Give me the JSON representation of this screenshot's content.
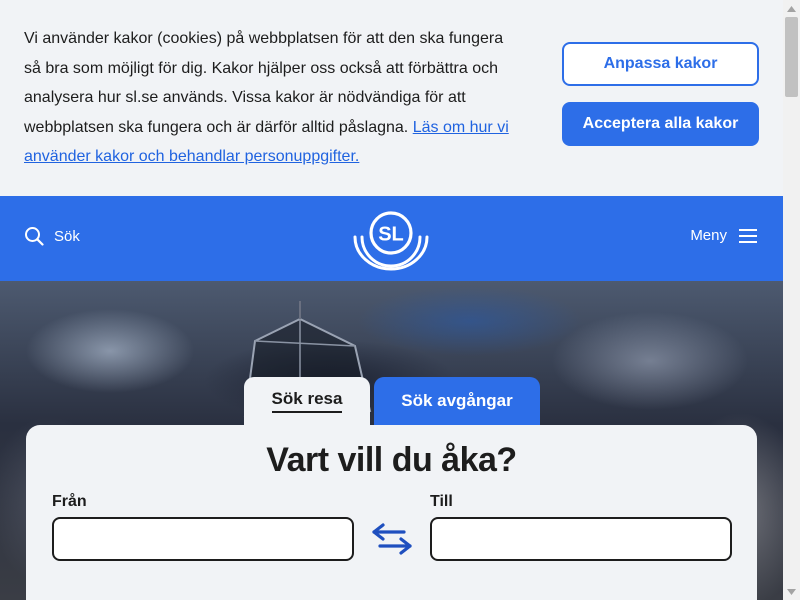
{
  "cookie_banner": {
    "text": "Vi använder kakor (cookies) på webbplatsen för att den ska fungera så bra som möjligt för dig. Kakor hjälper oss också att förbättra och analysera hur sl.se används. Vissa kakor är nödvändiga för att webbplatsen ska fungera och är därför alltid påslagna.",
    "link_text": "Läs om hur vi använder kakor och behandlar personuppgifter.",
    "customize_label": "Anpassa kakor",
    "accept_label": "Acceptera alla kakor"
  },
  "header": {
    "search_label": "Sök",
    "logo_text": "SL",
    "menu_label": "Meny",
    "icons": {
      "search": "search-icon",
      "menu": "hamburger-menu-icon",
      "logo": "sl-logo"
    }
  },
  "hero": {
    "tabs": [
      {
        "label": "Sök resa",
        "active": true
      },
      {
        "label": "Sök avgångar",
        "active": false
      }
    ],
    "title": "Vart vill du åka?",
    "from_label": "Från",
    "from_value": "",
    "to_label": "Till",
    "to_value": "",
    "swap_icon": "swap-arrows-icon"
  },
  "colors": {
    "brand_blue": "#2d6ee8",
    "banner_bg": "#f1f3f6",
    "text": "#1d1d1d",
    "link": "#2063e0"
  }
}
